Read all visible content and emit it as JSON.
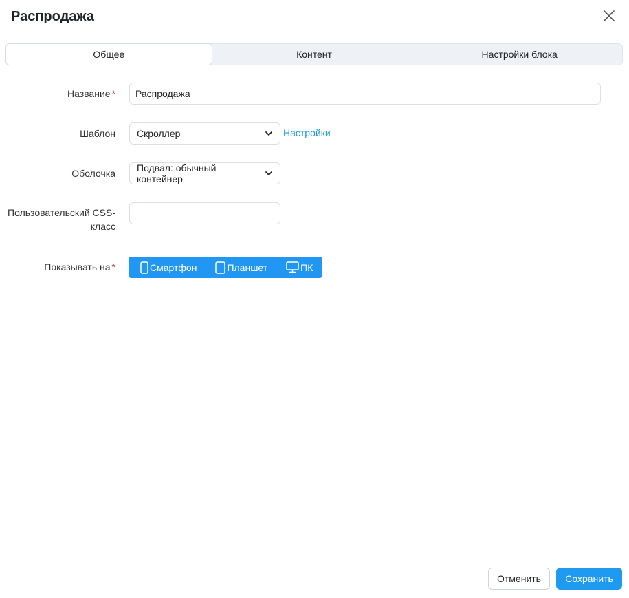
{
  "dialog": {
    "title": "Распродажа"
  },
  "tabs": [
    {
      "label": "Общее",
      "active": true
    },
    {
      "label": "Контент",
      "active": false
    },
    {
      "label": "Настройки блока",
      "active": false
    }
  ],
  "form": {
    "name": {
      "label": "Название",
      "required_mark": "*",
      "value": "Распродажа"
    },
    "template": {
      "label": "Шаблон",
      "value": "Скроллер",
      "settings_link": "Настройки"
    },
    "wrapper": {
      "label": "Оболочка",
      "value": "Подвал: обычный контейнер"
    },
    "css_class": {
      "label_line1": "Пользовательский CSS-",
      "label_line2": "класс",
      "value": ""
    },
    "show_on": {
      "label": "Показывать на",
      "required_mark": "*",
      "devices": [
        {
          "label": "Смартфон",
          "icon": "smartphone-icon"
        },
        {
          "label": "Планшет",
          "icon": "tablet-icon"
        },
        {
          "label": "ПК",
          "icon": "desktop-icon"
        }
      ]
    }
  },
  "footer": {
    "cancel_label": "Отменить",
    "save_label": "Сохранить"
  },
  "colors": {
    "accent": "#2196f3",
    "link": "#1a9be8",
    "required": "#e0394a"
  }
}
